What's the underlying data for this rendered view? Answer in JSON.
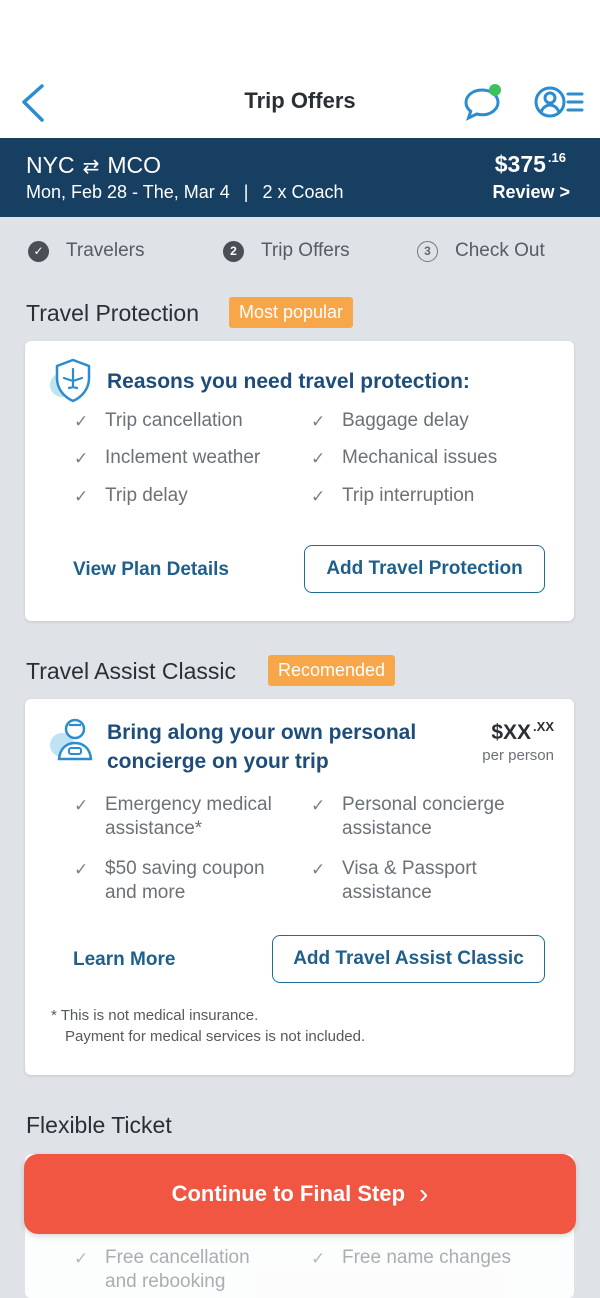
{
  "header": {
    "title": "Trip Offers",
    "back_icon": "chevron-left-icon",
    "chat_icon": "chat-bubble-icon",
    "profile_icon": "profile-menu-icon"
  },
  "trip": {
    "origin": "NYC",
    "swap_icon": "⇄",
    "destination": "MCO",
    "dates": "Mon, Feb 28 - The, Mar 4",
    "separator": "|",
    "passengers": "2 x Coach",
    "price_main": "$375",
    "price_cents": ".16",
    "review_label": "Review >"
  },
  "steps": [
    {
      "label": "Travelers",
      "marker": "✓",
      "state": "done"
    },
    {
      "label": "Trip Offers",
      "marker": "2",
      "state": "current"
    },
    {
      "label": "Check Out",
      "marker": "3",
      "state": "next"
    }
  ],
  "travel_protection": {
    "section_title": "Travel Protection",
    "tag": "Most popular",
    "heading": "Reasons you need travel protection:",
    "features": [
      "Trip cancellation",
      "Baggage delay",
      "Inclement weather",
      "Mechanical issues",
      "Trip delay",
      "Trip interruption"
    ],
    "link_label": "View Plan Details",
    "button_label": "Add Travel Protection"
  },
  "travel_assist": {
    "section_title": "Travel Assist Classic",
    "tag": "Recomended",
    "heading_line1": "Bring along your own personal",
    "heading_line2": "concierge on your trip",
    "price_main": "$XX",
    "price_cents": ".XX",
    "per_person": "per person",
    "features": [
      {
        "line1": "Emergency medical",
        "line2": "assistance*"
      },
      {
        "line1": "Personal concierge",
        "line2": "assistance"
      },
      {
        "line1": "$50 saving coupon",
        "line2": "and more"
      },
      {
        "line1": "Visa & Passport",
        "line2": "assistance"
      }
    ],
    "link_label": "Learn More",
    "button_label": "Add Travel Assist Classic",
    "disclaimer_line1": "* This is not medical insurance.",
    "disclaimer_line2": "Payment for medical services is not included."
  },
  "flexible_ticket": {
    "section_title": "Flexible Ticket",
    "features": [
      {
        "line1": "Free cancellation",
        "line2": "and rebooking"
      },
      {
        "line1": "Free name changes",
        "line2": ""
      }
    ]
  },
  "cta": {
    "label": "Continue to Final Step",
    "chevron": "›"
  },
  "colors": {
    "accent_navy": "#173f61",
    "link_blue": "#1f5f8b",
    "tag_orange": "#f7a64a",
    "cta_red": "#f15643"
  }
}
